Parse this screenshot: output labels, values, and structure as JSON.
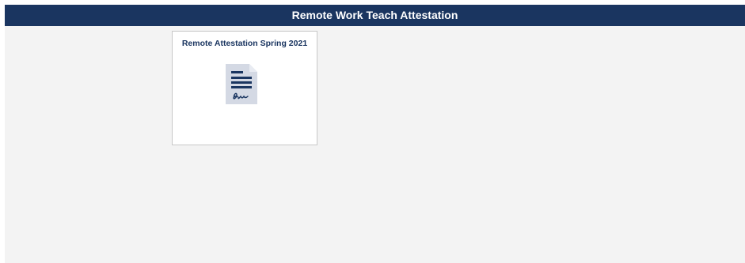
{
  "header": {
    "title": "Remote Work Teach Attestation"
  },
  "tiles": [
    {
      "title": "Remote Attestation Spring 2021",
      "icon": "signed-document-icon"
    }
  ],
  "colors": {
    "banner": "#1a3560",
    "tile_text": "#1a3560",
    "background": "#f3f3f3",
    "icon_page": "#d4d9e4"
  }
}
